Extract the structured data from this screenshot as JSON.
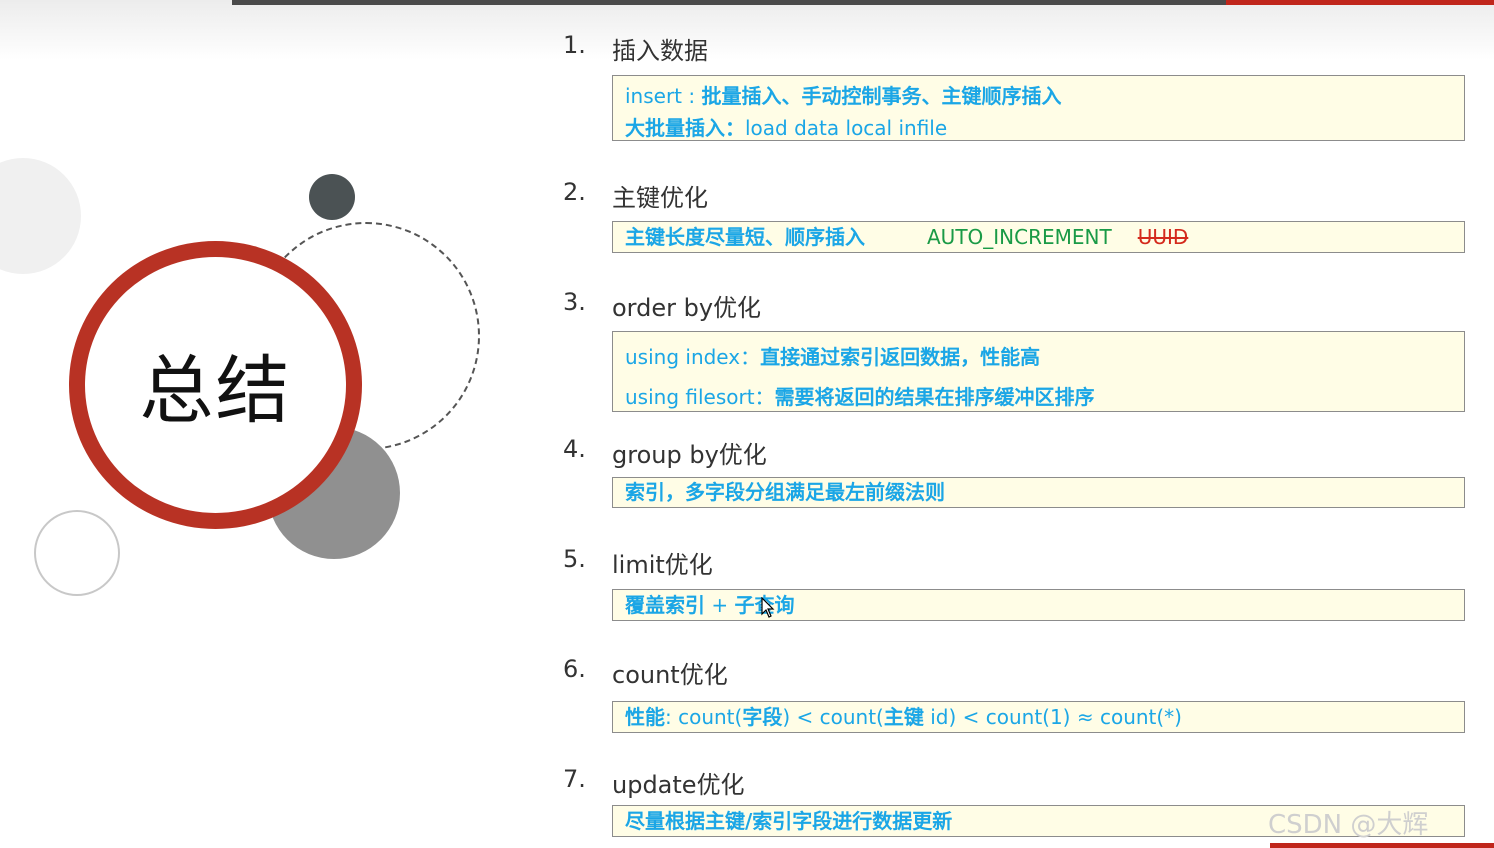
{
  "summary_title": "总结",
  "items": [
    {
      "num": "1.",
      "title": "插入数据",
      "box": {
        "l1a": "insert : ",
        "l1b": "批量插入、手动控制事务、主键顺序插入",
        "l2a": "大批量插入：",
        "l2b": "load  data  local  infile"
      }
    },
    {
      "num": "2.",
      "title": "主键优化",
      "box": {
        "a": "主键长度尽量短、顺序插入",
        "b": "AUTO_INCREMENT",
        "c": "UUID"
      }
    },
    {
      "num": "3.",
      "title": "order by优化",
      "box": {
        "l1a": "using index：",
        "l1b": "直接通过索引返回数据，性能高",
        "l2a": "using filesort：",
        "l2b": "需要将返回的结果在排序缓冲区排序"
      }
    },
    {
      "num": "4.",
      "title": "group by优化",
      "box": {
        "a": "索引，多字段分组满足最左前缀法则"
      }
    },
    {
      "num": "5.",
      "title": "limit优化",
      "box": {
        "a": "覆盖索引",
        "b": " + ",
        "c": "子查询"
      }
    },
    {
      "num": "6.",
      "title": "count优化",
      "box": {
        "a": "性能",
        "b": ": count(",
        "c": "字段",
        "d": ") < count(",
        "e": "主键",
        "f": " id) < count(1) ≈ count(*)"
      }
    },
    {
      "num": "7.",
      "title": "update优化",
      "box": {
        "a": "尽量根据主键/索引字段进行数据更新"
      }
    }
  ],
  "watermark": "CSDN @大辉",
  "colors": {
    "accent_red": "#b83224",
    "text_blue": "#1ba6e6",
    "text_green": "#1a9a46",
    "box_bg": "#fffde6"
  }
}
